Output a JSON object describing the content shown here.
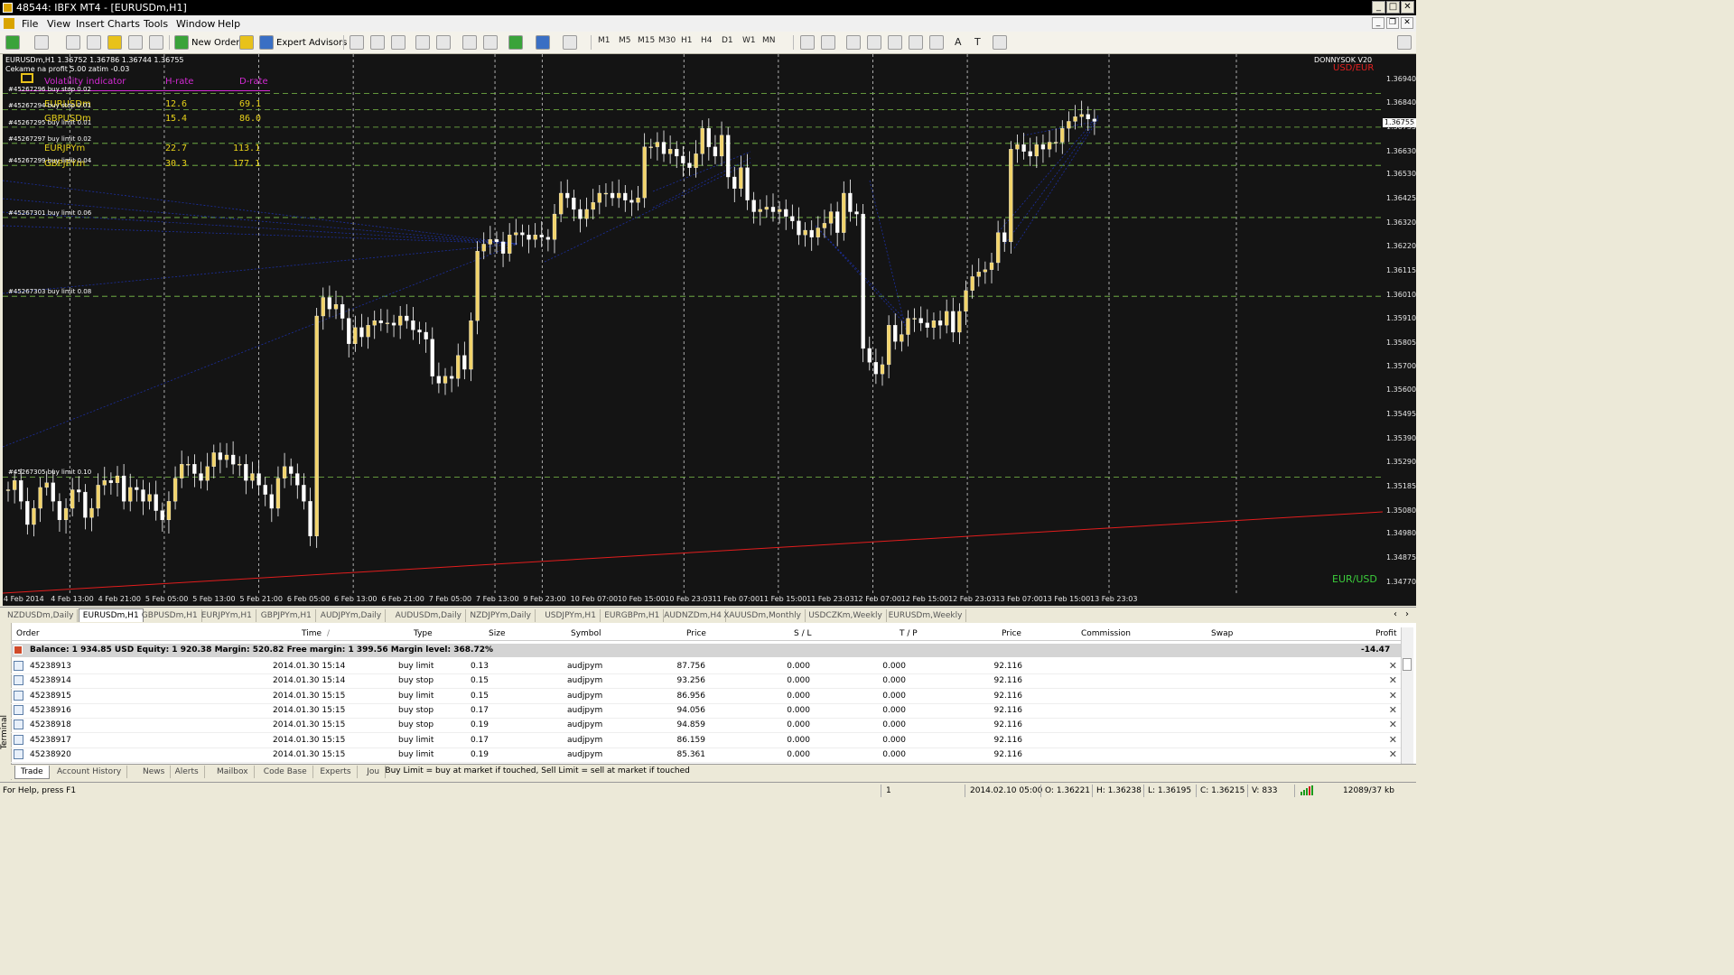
{
  "window": {
    "title": "48544: IBFX MT4 - [EURUSDm,H1]",
    "btn_min": "_",
    "btn_max": "□",
    "btn_close": "✕"
  },
  "mdi": {
    "btn_min": "_",
    "btn_restore": "❐",
    "btn_close": "✕"
  },
  "menu": [
    "File",
    "View",
    "Insert",
    "Charts",
    "Tools",
    "Window",
    "Help"
  ],
  "toolbar": {
    "new_order": "New Order",
    "expert_advisors": "Expert Advisors",
    "timeframes": [
      "M1",
      "M5",
      "M15",
      "M30",
      "H1",
      "H4",
      "D1",
      "W1",
      "MN"
    ],
    "text_tool": "A",
    "label_tool": "T"
  },
  "chart": {
    "symbol_line": "EURUSDm,H1  1.36752 1.36786 1.36744 1.36755",
    "profit_line": "Cekame na profit 5.00  zatim -0.03",
    "brand": "DONNYSOK V20",
    "brand_sub": "USD/EUR",
    "pair_label": "EUR/USD",
    "current_price": "1.36755",
    "volatility": {
      "title": "Volatility indicator",
      "h_head": "H-rate",
      "d_head": "D-rate",
      "rows": [
        {
          "pair": "EURUSDm",
          "h": "12.6",
          "d": "69.1"
        },
        {
          "pair": "GBPUSDm",
          "h": "15.4",
          "d": "86.0"
        },
        {
          "pair": "EURJPYm",
          "h": "22.7",
          "d": "113.1"
        },
        {
          "pair": "GBPJPYm",
          "h": "30.3",
          "d": "177.1"
        }
      ]
    },
    "order_lines": [
      {
        "label": "#45267296 buy stop 0.02",
        "price": 1.3688
      },
      {
        "label": "#45267294 buy stop 0.01",
        "price": 1.3681
      },
      {
        "label": "#45267295 buy limit 0.01",
        "price": 1.36735
      },
      {
        "label": "#45267297 buy limit 0.02",
        "price": 1.36665
      },
      {
        "label": "#45267299 buy limit 0.04",
        "price": 1.3657
      },
      {
        "label": "#45267301 buy limit 0.06",
        "price": 1.36345
      },
      {
        "label": "#45267303 buy limit 0.08",
        "price": 1.36005
      },
      {
        "label": "#45267305 buy limit 0.10",
        "price": 1.35225
      }
    ],
    "price_ticks": [
      "1.36940",
      "1.36840",
      "1.36735",
      "1.36630",
      "1.36530",
      "1.36425",
      "1.36320",
      "1.36220",
      "1.36115",
      "1.36010",
      "1.35910",
      "1.35805",
      "1.35700",
      "1.35600",
      "1.35495",
      "1.35390",
      "1.35290",
      "1.35185",
      "1.35080",
      "1.34980",
      "1.34875",
      "1.34770"
    ],
    "time_ticks": [
      "4 Feb 2014",
      "4 Feb 13:00",
      "4 Feb 21:00",
      "5 Feb 05:00",
      "5 Feb 13:00",
      "5 Feb 21:00",
      "6 Feb 05:00",
      "6 Feb 13:00",
      "6 Feb 21:00",
      "7 Feb 05:00",
      "7 Feb 13:00",
      "9 Feb 23:00",
      "10 Feb 07:00",
      "10 Feb 15:00",
      "10 Feb 23:03",
      "11 Feb 07:00",
      "11 Feb 15:00",
      "11 Feb 23:03",
      "12 Feb 07:00",
      "12 Feb 15:00",
      "12 Feb 23:03",
      "13 Feb 07:00",
      "13 Feb 15:00",
      "13 Feb 23:03"
    ]
  },
  "chart_data": {
    "type": "candlestick",
    "title": "EURUSDm,H1",
    "ylim": [
      1.3472,
      1.3705
    ],
    "grid": true,
    "candle_colors": {
      "up": "#f2d46b",
      "down": "#ffffff",
      "wick": "#ffffff"
    },
    "series": [
      {
        "close": [
          1.3517,
          1.3521,
          1.3512,
          1.3502,
          1.3509,
          1.3518,
          1.352,
          1.3512,
          1.3504,
          1.3509,
          1.3517,
          1.3516,
          1.3505,
          1.3509,
          1.3519,
          1.3521,
          1.352,
          1.3523,
          1.3512,
          1.3518,
          1.3517,
          1.3512,
          1.3515,
          1.3508,
          1.3504,
          1.3512,
          1.3522,
          1.3528,
          1.3528,
          1.3524,
          1.3521,
          1.3527,
          1.3533,
          1.353,
          1.3532,
          1.3528,
          1.3528,
          1.3521,
          1.3524,
          1.3519,
          1.3515,
          1.3509,
          1.3522,
          1.3527,
          1.3524,
          1.3519,
          1.3512,
          1.3497,
          1.3592,
          1.36,
          1.3595,
          1.3597,
          1.3591,
          1.358,
          1.3587,
          1.3583,
          1.3588,
          1.359,
          1.3589,
          1.3589,
          1.3588,
          1.3592,
          1.359,
          1.3586,
          1.3585,
          1.3582,
          1.3566,
          1.3563,
          1.3566,
          1.3565,
          1.3575,
          1.3569,
          1.359,
          1.362,
          1.3623,
          1.3625,
          1.3624,
          1.3619,
          1.3627,
          1.3628,
          1.3627,
          1.3625,
          1.3627,
          1.3626,
          1.3625,
          1.3636,
          1.3645,
          1.3643,
          1.3638,
          1.3634,
          1.3638,
          1.3641,
          1.3645,
          1.3645,
          1.3643,
          1.3645,
          1.3642,
          1.3641,
          1.3643,
          1.3665,
          1.3665,
          1.3667,
          1.3662,
          1.3664,
          1.3661,
          1.3658,
          1.3656,
          1.3662,
          1.3673,
          1.3665,
          1.3661,
          1.367,
          1.3652,
          1.3647,
          1.3656,
          1.3642,
          1.3637,
          1.3638,
          1.3639,
          1.3637,
          1.3638,
          1.3635,
          1.3633,
          1.3627,
          1.3629,
          1.3626,
          1.363,
          1.3632,
          1.3637,
          1.3628,
          1.3645,
          1.3637,
          1.3636,
          1.3578,
          1.3572,
          1.3567,
          1.3571,
          1.3588,
          1.3581,
          1.3584,
          1.3591,
          1.3591,
          1.3589,
          1.3587,
          1.359,
          1.3588,
          1.3594,
          1.3585,
          1.3594,
          1.3603,
          1.3609,
          1.3611,
          1.3612,
          1.3615,
          1.3628,
          1.3624,
          1.3664,
          1.3666,
          1.3663,
          1.3661,
          1.3666,
          1.3664,
          1.3667,
          1.3667,
          1.3673,
          1.3676,
          1.3678,
          1.3679,
          1.3677,
          1.3676
        ]
      }
    ]
  },
  "symbol_tabs": [
    "NZDUSDm,Daily",
    "EURUSDm,H1",
    "GBPUSDm,H1",
    "EURJPYm,H1",
    "GBPJPYm,H1",
    "AUDJPYm,Daily",
    "AUDUSDm,Daily",
    "NZDJPYm,Daily",
    "USDJPYm,H1",
    "EURGBPm,H1",
    "AUDNZDm,H4",
    "XAUUSDm,Monthly",
    "USDCZKm,Weekly",
    "EURUSDm,Weekly"
  ],
  "terminal": {
    "side_label": "Terminal",
    "headers": {
      "order": "Order",
      "time": "Time",
      "sort": "/",
      "type": "Type",
      "size": "Size",
      "symbol": "Symbol",
      "price": "Price",
      "sl": "S / L",
      "tp": "T / P",
      "price2": "Price",
      "commission": "Commission",
      "swap": "Swap",
      "profit": "Profit"
    },
    "balance": "Balance: 1 934.85 USD  Equity: 1 920.38  Margin: 520.82  Free margin: 1 399.56  Margin level: 368.72%",
    "balance_profit": "-14.47",
    "rows": [
      {
        "order": "45238913",
        "time": "2014.01.30 15:14",
        "type": "buy limit",
        "size": "0.13",
        "symbol": "audjpym",
        "price": "87.756",
        "sl": "0.000",
        "tp": "0.000",
        "price2": "92.116"
      },
      {
        "order": "45238914",
        "time": "2014.01.30 15:14",
        "type": "buy stop",
        "size": "0.15",
        "symbol": "audjpym",
        "price": "93.256",
        "sl": "0.000",
        "tp": "0.000",
        "price2": "92.116"
      },
      {
        "order": "45238915",
        "time": "2014.01.30 15:15",
        "type": "buy limit",
        "size": "0.15",
        "symbol": "audjpym",
        "price": "86.956",
        "sl": "0.000",
        "tp": "0.000",
        "price2": "92.116"
      },
      {
        "order": "45238916",
        "time": "2014.01.30 15:15",
        "type": "buy stop",
        "size": "0.17",
        "symbol": "audjpym",
        "price": "94.056",
        "sl": "0.000",
        "tp": "0.000",
        "price2": "92.116"
      },
      {
        "order": "45238918",
        "time": "2014.01.30 15:15",
        "type": "buy stop",
        "size": "0.19",
        "symbol": "audjpym",
        "price": "94.859",
        "sl": "0.000",
        "tp": "0.000",
        "price2": "92.116"
      },
      {
        "order": "45238917",
        "time": "2014.01.30 15:15",
        "type": "buy limit",
        "size": "0.17",
        "symbol": "audjpym",
        "price": "86.159",
        "sl": "0.000",
        "tp": "0.000",
        "price2": "92.116"
      },
      {
        "order": "45238920",
        "time": "2014.01.30 15:15",
        "type": "buy limit",
        "size": "0.19",
        "symbol": "audjpym",
        "price": "85.361",
        "sl": "0.000",
        "tp": "0.000",
        "price2": "92.116"
      }
    ],
    "tabs": [
      "Trade",
      "Account History",
      "News",
      "Alerts",
      "Mailbox",
      "Code Base",
      "Experts",
      "Jou"
    ],
    "hint": "Buy Limit = buy at market if touched, Sell Limit = sell at market if touched"
  },
  "status": {
    "help": "For Help, press F1",
    "profile": "1",
    "datetime": "2014.02.10 05:00",
    "open": "O: 1.36221",
    "high": "H: 1.36238",
    "low": "L: 1.36195",
    "close": "C: 1.36215",
    "volume": "V: 833",
    "traffic": "12089/37 kb"
  },
  "colors": {
    "chart_bg": "#141414",
    "grid": "#6fa84b",
    "order_line": "#7cc04a",
    "volatility_title": "#d22ad2",
    "volatility_values": "#e8d21a",
    "trend_line": "#e21d1d",
    "blue_lines": "#1c2fa0",
    "pair_label": "#3ccd3c",
    "brand_sub": "#e02020"
  }
}
